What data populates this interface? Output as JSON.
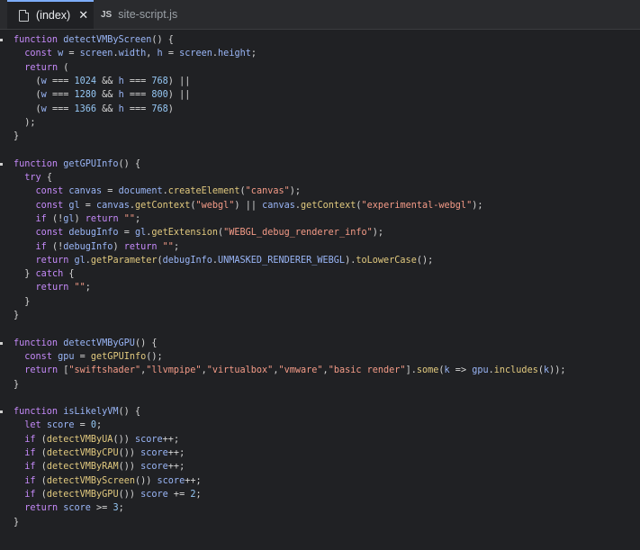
{
  "tabs": [
    {
      "label": "(index)",
      "icon": "file-icon",
      "active": true
    },
    {
      "label": "site-script.js",
      "icon": "js-file-icon",
      "badge": "JS",
      "active": false
    }
  ],
  "code_lines": [
    [
      [
        "k",
        "function "
      ],
      [
        "d",
        "detectVMByScreen"
      ],
      [
        "p",
        "() {"
      ]
    ],
    [
      [
        "p",
        "  "
      ],
      [
        "k",
        "const "
      ],
      [
        "d",
        "w"
      ],
      [
        "p",
        " = "
      ],
      [
        "d",
        "screen"
      ],
      [
        "p",
        "."
      ],
      [
        "d",
        "width"
      ],
      [
        "p",
        ", "
      ],
      [
        "d",
        "h"
      ],
      [
        "p",
        " = "
      ],
      [
        "d",
        "screen"
      ],
      [
        "p",
        "."
      ],
      [
        "d",
        "height"
      ],
      [
        "p",
        ";"
      ]
    ],
    [
      [
        "p",
        "  "
      ],
      [
        "k",
        "return"
      ],
      [
        "p",
        " ("
      ]
    ],
    [
      [
        "p",
        "    ("
      ],
      [
        "d",
        "w"
      ],
      [
        "p",
        " === "
      ],
      [
        "n",
        "1024"
      ],
      [
        "p",
        " && "
      ],
      [
        "d",
        "h"
      ],
      [
        "p",
        " === "
      ],
      [
        "n",
        "768"
      ],
      [
        "p",
        ") ||"
      ]
    ],
    [
      [
        "p",
        "    ("
      ],
      [
        "d",
        "w"
      ],
      [
        "p",
        " === "
      ],
      [
        "n",
        "1280"
      ],
      [
        "p",
        " && "
      ],
      [
        "d",
        "h"
      ],
      [
        "p",
        " === "
      ],
      [
        "n",
        "800"
      ],
      [
        "p",
        ") ||"
      ]
    ],
    [
      [
        "p",
        "    ("
      ],
      [
        "d",
        "w"
      ],
      [
        "p",
        " === "
      ],
      [
        "n",
        "1366"
      ],
      [
        "p",
        " && "
      ],
      [
        "d",
        "h"
      ],
      [
        "p",
        " === "
      ],
      [
        "n",
        "768"
      ],
      [
        "p",
        ")"
      ]
    ],
    [
      [
        "p",
        "  );"
      ]
    ],
    [
      [
        "p",
        "}"
      ]
    ],
    [],
    [
      [
        "k",
        "function "
      ],
      [
        "d",
        "getGPUInfo"
      ],
      [
        "p",
        "() {"
      ]
    ],
    [
      [
        "p",
        "  "
      ],
      [
        "k",
        "try"
      ],
      [
        "p",
        " {"
      ]
    ],
    [
      [
        "p",
        "    "
      ],
      [
        "k",
        "const "
      ],
      [
        "d",
        "canvas"
      ],
      [
        "p",
        " = "
      ],
      [
        "d",
        "document"
      ],
      [
        "p",
        "."
      ],
      [
        "f",
        "createElement"
      ],
      [
        "p",
        "("
      ],
      [
        "s",
        "\"canvas\""
      ],
      [
        "p",
        ");"
      ]
    ],
    [
      [
        "p",
        "    "
      ],
      [
        "k",
        "const "
      ],
      [
        "d",
        "gl"
      ],
      [
        "p",
        " = "
      ],
      [
        "d",
        "canvas"
      ],
      [
        "p",
        "."
      ],
      [
        "f",
        "getContext"
      ],
      [
        "p",
        "("
      ],
      [
        "s",
        "\"webgl\""
      ],
      [
        "p",
        ") || "
      ],
      [
        "d",
        "canvas"
      ],
      [
        "p",
        "."
      ],
      [
        "f",
        "getContext"
      ],
      [
        "p",
        "("
      ],
      [
        "s",
        "\"experimental-webgl\""
      ],
      [
        "p",
        ");"
      ]
    ],
    [
      [
        "p",
        "    "
      ],
      [
        "k",
        "if"
      ],
      [
        "p",
        " (!"
      ],
      [
        "d",
        "gl"
      ],
      [
        "p",
        ") "
      ],
      [
        "k",
        "return "
      ],
      [
        "s",
        "\"\""
      ],
      [
        "p",
        ";"
      ]
    ],
    [
      [
        "p",
        "    "
      ],
      [
        "k",
        "const "
      ],
      [
        "d",
        "debugInfo"
      ],
      [
        "p",
        " = "
      ],
      [
        "d",
        "gl"
      ],
      [
        "p",
        "."
      ],
      [
        "f",
        "getExtension"
      ],
      [
        "p",
        "("
      ],
      [
        "s",
        "\"WEBGL_debug_renderer_info\""
      ],
      [
        "p",
        ");"
      ]
    ],
    [
      [
        "p",
        "    "
      ],
      [
        "k",
        "if"
      ],
      [
        "p",
        " (!"
      ],
      [
        "d",
        "debugInfo"
      ],
      [
        "p",
        ") "
      ],
      [
        "k",
        "return "
      ],
      [
        "s",
        "\"\""
      ],
      [
        "p",
        ";"
      ]
    ],
    [
      [
        "p",
        "    "
      ],
      [
        "k",
        "return "
      ],
      [
        "d",
        "gl"
      ],
      [
        "p",
        "."
      ],
      [
        "f",
        "getParameter"
      ],
      [
        "p",
        "("
      ],
      [
        "d",
        "debugInfo"
      ],
      [
        "p",
        "."
      ],
      [
        "d",
        "UNMASKED_RENDERER_WEBGL"
      ],
      [
        "p",
        ")."
      ],
      [
        "f",
        "toLowerCase"
      ],
      [
        "p",
        "();"
      ]
    ],
    [
      [
        "p",
        "  } "
      ],
      [
        "k",
        "catch"
      ],
      [
        "p",
        " {"
      ]
    ],
    [
      [
        "p",
        "    "
      ],
      [
        "k",
        "return "
      ],
      [
        "s",
        "\"\""
      ],
      [
        "p",
        ";"
      ]
    ],
    [
      [
        "p",
        "  }"
      ]
    ],
    [
      [
        "p",
        "}"
      ]
    ],
    [],
    [
      [
        "k",
        "function "
      ],
      [
        "d",
        "detectVMByGPU"
      ],
      [
        "p",
        "() {"
      ]
    ],
    [
      [
        "p",
        "  "
      ],
      [
        "k",
        "const "
      ],
      [
        "d",
        "gpu"
      ],
      [
        "p",
        " = "
      ],
      [
        "f",
        "getGPUInfo"
      ],
      [
        "p",
        "();"
      ]
    ],
    [
      [
        "p",
        "  "
      ],
      [
        "k",
        "return "
      ],
      [
        "p",
        "["
      ],
      [
        "s",
        "\"swiftshader\""
      ],
      [
        "p",
        ","
      ],
      [
        "s",
        "\"llvmpipe\""
      ],
      [
        "p",
        ","
      ],
      [
        "s",
        "\"virtualbox\""
      ],
      [
        "p",
        ","
      ],
      [
        "s",
        "\"vmware\""
      ],
      [
        "p",
        ","
      ],
      [
        "s",
        "\"basic render\""
      ],
      [
        "p",
        "]."
      ],
      [
        "f",
        "some"
      ],
      [
        "p",
        "("
      ],
      [
        "d",
        "k"
      ],
      [
        "p",
        " => "
      ],
      [
        "d",
        "gpu"
      ],
      [
        "p",
        "."
      ],
      [
        "f",
        "includes"
      ],
      [
        "p",
        "("
      ],
      [
        "d",
        "k"
      ],
      [
        "p",
        "));"
      ]
    ],
    [
      [
        "p",
        "}"
      ]
    ],
    [],
    [
      [
        "k",
        "function "
      ],
      [
        "d",
        "isLikelyVM"
      ],
      [
        "p",
        "() {"
      ]
    ],
    [
      [
        "p",
        "  "
      ],
      [
        "k",
        "let "
      ],
      [
        "d",
        "score"
      ],
      [
        "p",
        " = "
      ],
      [
        "n",
        "0"
      ],
      [
        "p",
        ";"
      ]
    ],
    [
      [
        "p",
        "  "
      ],
      [
        "k",
        "if"
      ],
      [
        "p",
        " ("
      ],
      [
        "f",
        "detectVMByUA"
      ],
      [
        "p",
        "()) "
      ],
      [
        "d",
        "score"
      ],
      [
        "p",
        "++;"
      ]
    ],
    [
      [
        "p",
        "  "
      ],
      [
        "k",
        "if"
      ],
      [
        "p",
        " ("
      ],
      [
        "f",
        "detectVMByCPU"
      ],
      [
        "p",
        "()) "
      ],
      [
        "d",
        "score"
      ],
      [
        "p",
        "++;"
      ]
    ],
    [
      [
        "p",
        "  "
      ],
      [
        "k",
        "if"
      ],
      [
        "p",
        " ("
      ],
      [
        "f",
        "detectVMByRAM"
      ],
      [
        "p",
        "()) "
      ],
      [
        "d",
        "score"
      ],
      [
        "p",
        "++;"
      ]
    ],
    [
      [
        "p",
        "  "
      ],
      [
        "k",
        "if"
      ],
      [
        "p",
        " ("
      ],
      [
        "f",
        "detectVMByScreen"
      ],
      [
        "p",
        "()) "
      ],
      [
        "d",
        "score"
      ],
      [
        "p",
        "++;"
      ]
    ],
    [
      [
        "p",
        "  "
      ],
      [
        "k",
        "if"
      ],
      [
        "p",
        " ("
      ],
      [
        "f",
        "detectVMByGPU"
      ],
      [
        "p",
        "()) "
      ],
      [
        "d",
        "score"
      ],
      [
        "p",
        " += "
      ],
      [
        "n",
        "2"
      ],
      [
        "p",
        ";"
      ]
    ],
    [
      [
        "p",
        "  "
      ],
      [
        "k",
        "return "
      ],
      [
        "d",
        "score"
      ],
      [
        "p",
        " >= "
      ],
      [
        "n",
        "3"
      ],
      [
        "p",
        ";"
      ]
    ],
    [
      [
        "p",
        "}"
      ]
    ]
  ],
  "gutter_marker_lines": [
    0,
    9,
    22,
    27
  ]
}
